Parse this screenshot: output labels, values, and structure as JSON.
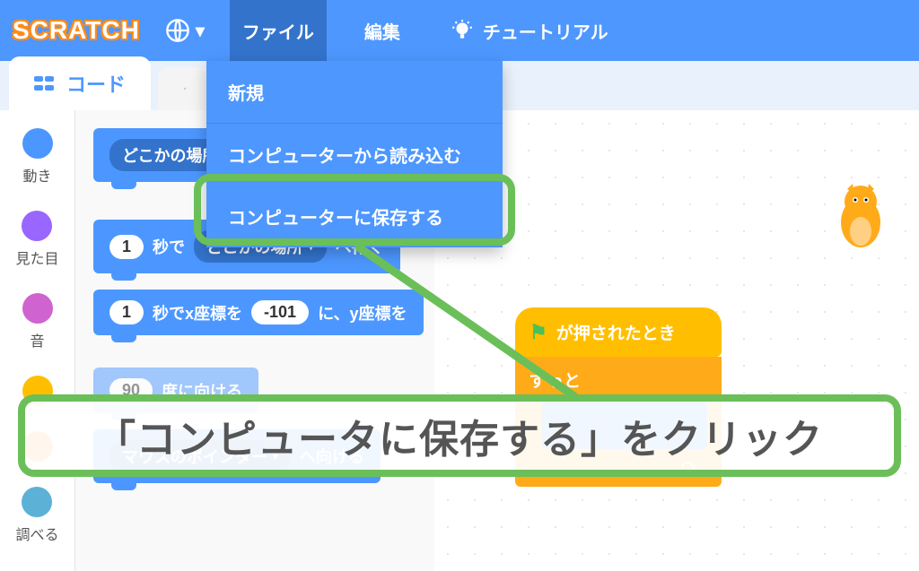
{
  "menubar": {
    "logo": "SCRATCH",
    "file": "ファイル",
    "edit": "編集",
    "tutorials": "チュートリアル"
  },
  "dropdown": {
    "new": "新規",
    "load": "コンピューターから読み込む",
    "save": "コンピューターに保存する"
  },
  "tabs": {
    "code": "コード"
  },
  "categories": {
    "motion": "動き",
    "looks": "見た目",
    "sound": "音",
    "sensing": "調べる"
  },
  "blocks": {
    "go_random": "どこかの場所",
    "set_x": "x座標を",
    "set_x_val": "-101",
    "glide_secs": "1",
    "glide_label1": "秒で",
    "glide_target": "どこかの場所",
    "glide_label2": "へ行く",
    "glide2_secs": "1",
    "glide2_label": "秒でx座標を",
    "glide2_x": "-101",
    "glide2_label2": "に、y座標を",
    "point_dir_val": "90",
    "point_dir_label": "度に向ける",
    "point_towards": "マウスのポインター",
    "point_towards_label": "へ向ける"
  },
  "script": {
    "when_flag": "が押されたとき",
    "forever": "ずっと"
  },
  "callout": "「コンピュータに保存する」をクリック"
}
